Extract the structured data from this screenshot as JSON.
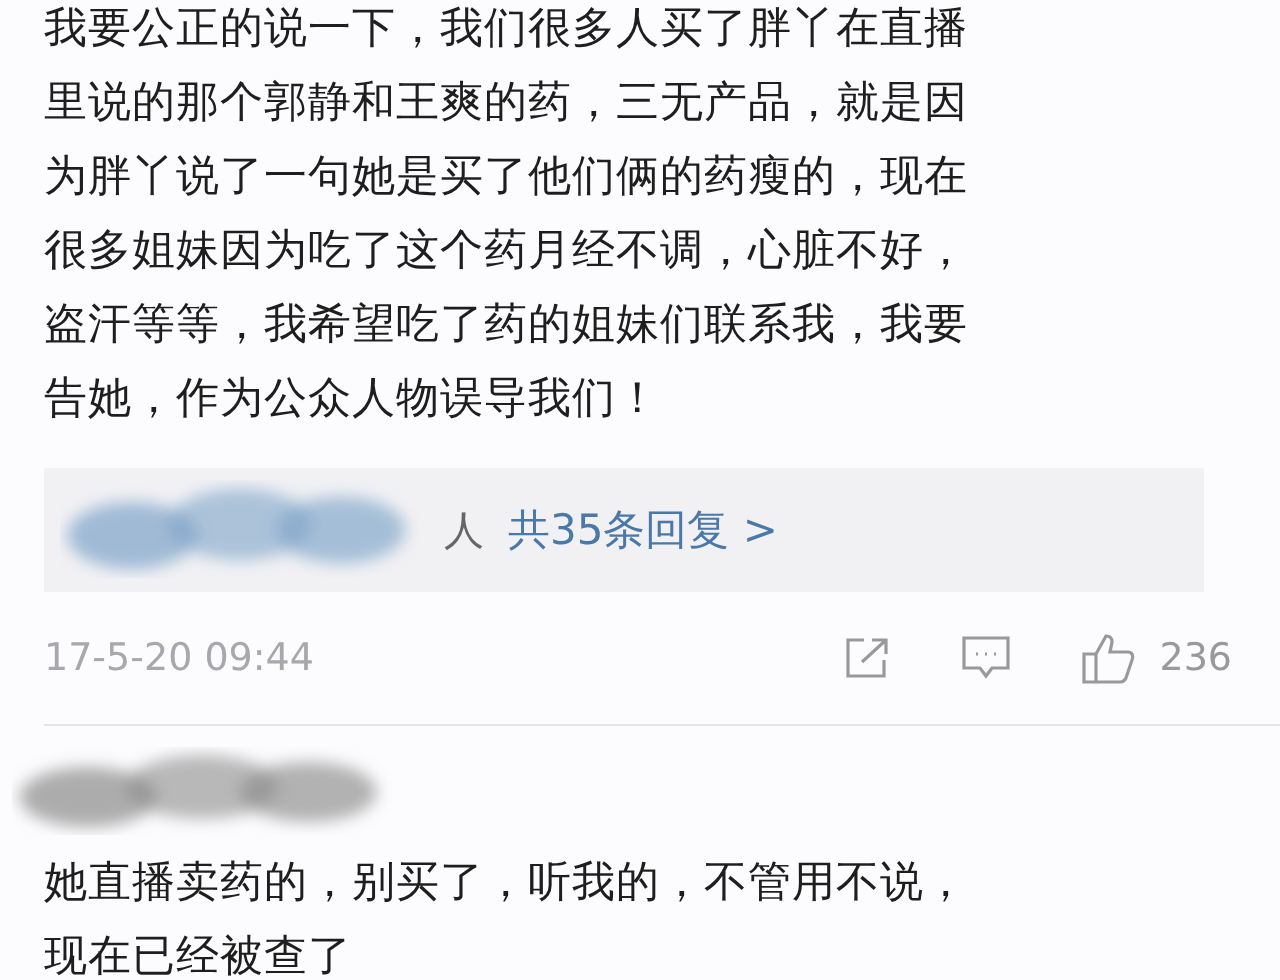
{
  "comments": [
    {
      "lines": [
        "我要公正的说一下，我们很多人买了胖丫在直播",
        "里说的那个郭静和王爽的药，三无产品，就是因",
        "为胖丫说了一句她是买了他们俩的药瘦的，现在",
        "很多姐妹因为吃了这个药月经不调，心脏不好，",
        "盗汗等等，我希望吃了药的姐妹们联系我，我要",
        "告她，作为公众人物误导我们！"
      ],
      "replies": {
        "names_tail": "人",
        "link": "共35条回复 >"
      },
      "time": "17-5-20 09:44",
      "likes": "236"
    },
    {
      "lines": [
        "她直播卖药的，别买了，听我的，不管用不说，",
        "现在已经被查了"
      ]
    }
  ]
}
